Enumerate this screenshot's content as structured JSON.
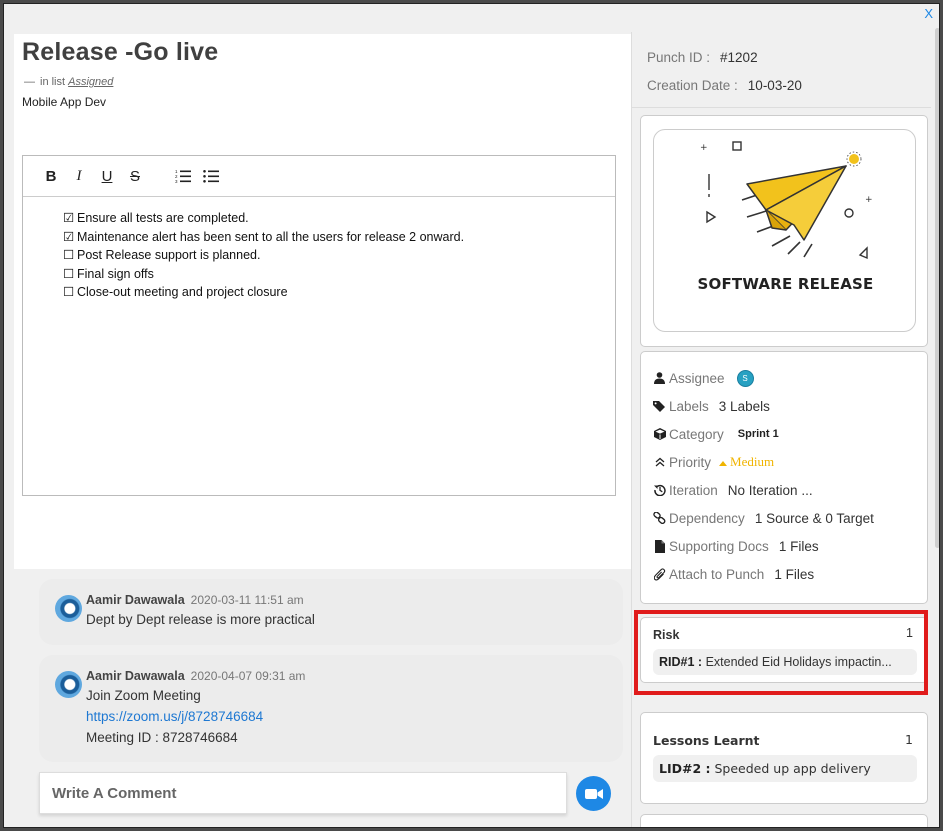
{
  "window": {
    "close_label": "X"
  },
  "task": {
    "title": "Release -Go live",
    "list_prefix": "in list",
    "list_name": "Assigned",
    "project": "Mobile App Dev"
  },
  "editor": {
    "toolbar": {
      "bold": "B",
      "italic": "I",
      "underline": "U",
      "strike": "S"
    },
    "checklist": [
      {
        "checked": true,
        "mark": "☑",
        "text": "Ensure all tests are completed."
      },
      {
        "checked": true,
        "mark": "☑",
        "text": "Maintenance alert has been sent to all the users for release 2 onward."
      },
      {
        "checked": false,
        "mark": "☐",
        "text": "Post Release support is planned."
      },
      {
        "checked": false,
        "mark": "☐",
        "text": "Final sign offs"
      },
      {
        "checked": false,
        "mark": "☐",
        "text": "Close-out meeting and project closure"
      }
    ]
  },
  "comments": [
    {
      "author": "Aamir Dawawala",
      "date": "2020-03-11 11:51 am",
      "lines": [
        "Dept by Dept release is more practical"
      ]
    },
    {
      "author": "Aamir Dawawala",
      "date": "2020-04-07 09:31 am",
      "lines": [
        "Join Zoom Meeting",
        "https://zoom.us/j/8728746684",
        "Meeting ID : 8728746684"
      ]
    }
  ],
  "comment_input": {
    "placeholder": "Write A Comment"
  },
  "meta": {
    "punch_id_label": "Punch ID :",
    "punch_id": "#1202",
    "creation_date_label": "Creation Date :",
    "creation_date": "10-03-20"
  },
  "image": {
    "caption": "SOFTWARE RELEASE"
  },
  "details": {
    "assignee_label": "Assignee",
    "assignee_badge": "S",
    "labels_label": "Labels",
    "labels_value": "3 Labels",
    "category_label": "Category",
    "category_value": "Sprint 1",
    "priority_label": "Priority",
    "priority_value": "Medium",
    "iteration_label": "Iteration",
    "iteration_value": "No Iteration ...",
    "dependency_label": "Dependency",
    "dependency_value": "1 Source & 0 Target",
    "docs_label": "Supporting Docs",
    "docs_value": "1 Files",
    "attach_label": "Attach to Punch",
    "attach_value": "1 Files"
  },
  "risk": {
    "title": "Risk",
    "count": "1",
    "id": "RID#1 :",
    "text": "Extended Eid Holidays impactin..."
  },
  "lessons": {
    "title": "Lessons Learnt",
    "count": "1",
    "id": "LID#2 :",
    "text": "Speeded up app delivery"
  },
  "colors": {
    "accent": "#1e88e5",
    "highlight": "#e01b1b",
    "priority": "#f0b400",
    "badge": "#27a1c2"
  }
}
